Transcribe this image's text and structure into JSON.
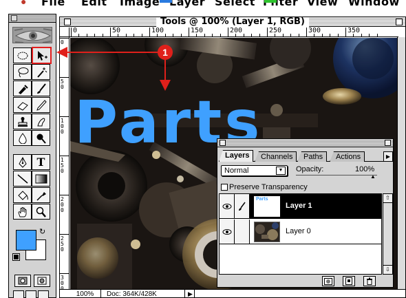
{
  "menubar": {
    "items": [
      "File",
      "Edit",
      "Image",
      "Layer",
      "Select",
      "Filter",
      "View",
      "Window"
    ]
  },
  "toolbox": {
    "tools": [
      {
        "name": "marquee-tool",
        "selected": false
      },
      {
        "name": "move-tool",
        "selected": true
      },
      {
        "name": "lasso-tool",
        "selected": false
      },
      {
        "name": "magic-wand-tool",
        "selected": false
      },
      {
        "name": "airbrush-tool",
        "selected": false
      },
      {
        "name": "paintbrush-tool",
        "selected": false
      },
      {
        "name": "eraser-tool",
        "selected": false
      },
      {
        "name": "pencil-tool",
        "selected": false
      },
      {
        "name": "rubber-stamp-tool",
        "selected": false
      },
      {
        "name": "smudge-tool",
        "selected": false
      },
      {
        "name": "blur-tool",
        "selected": false
      },
      {
        "name": "dodge-tool",
        "selected": false
      },
      {
        "name": "pen-tool",
        "selected": false
      },
      {
        "name": "type-tool",
        "selected": false
      },
      {
        "name": "line-tool",
        "selected": false
      },
      {
        "name": "gradient-tool",
        "selected": false
      },
      {
        "name": "paint-bucket-tool",
        "selected": false
      },
      {
        "name": "eyedropper-tool",
        "selected": false
      },
      {
        "name": "hand-tool",
        "selected": false
      },
      {
        "name": "zoom-tool",
        "selected": false
      }
    ],
    "type_tool_glyph": "T",
    "foreground_color": "#3fa0ff",
    "background_color": "#ffffff"
  },
  "document": {
    "title": "Tools @ 100% (Layer 1, RGB)",
    "canvas_text": "Parts",
    "text_color": "#3fa0ff",
    "hruler_labels": [
      "0",
      "50",
      "100",
      "150",
      "200",
      "250",
      "300",
      "350"
    ],
    "vruler_labels": [
      "0",
      "50",
      "100",
      "150",
      "200",
      "250",
      "300"
    ],
    "zoom": "100%",
    "doc_size": "Doc: 364K/428K"
  },
  "callout": {
    "number": "1",
    "color": "#e0201b"
  },
  "layers_palette": {
    "tabs": [
      "Layers",
      "Channels",
      "Paths",
      "Actions"
    ],
    "active_tab": "Layers",
    "blend_mode": "Normal",
    "opacity_label": "Opacity:",
    "opacity_value": "100%",
    "preserve_label": "Preserve Transparency",
    "preserve_checked": false,
    "layers": [
      {
        "name": "Layer 1",
        "thumb_text": "Parts",
        "active": true
      },
      {
        "name": "Layer 0",
        "active": false
      }
    ]
  }
}
